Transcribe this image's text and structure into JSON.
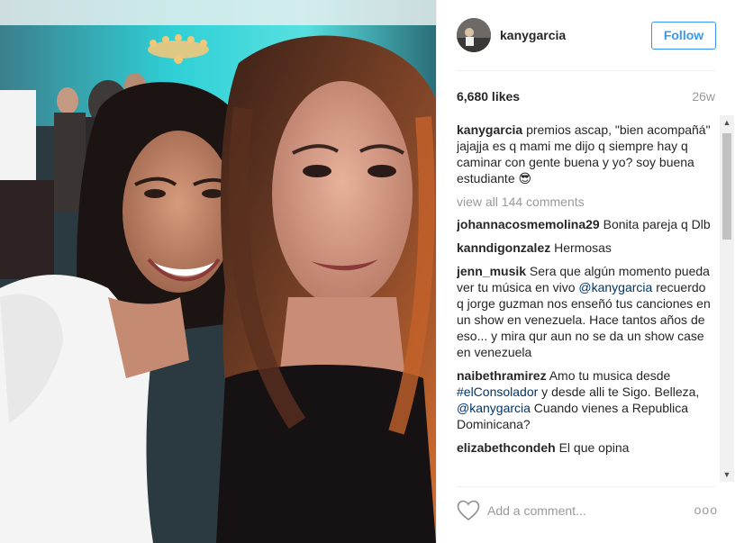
{
  "post": {
    "username": "kanygarcia",
    "follow_label": "Follow",
    "likes": "6,680 likes",
    "age": "26w",
    "caption": {
      "username": "kanygarcia",
      "text": "premios ascap, \"bien acompañá\" jajajja es q mami me dijo q siempre hay q caminar con gente buena y yo? soy buena estudiante 😎"
    },
    "view_all": "view all 144 comments",
    "comments": [
      {
        "username": "johannacosmemolina29",
        "parts": [
          {
            "t": "Bonita pareja q Dlb",
            "m": false
          }
        ]
      },
      {
        "username": "kanndigonzalez",
        "parts": [
          {
            "t": "Hermosas",
            "m": false
          }
        ]
      },
      {
        "username": "jenn_musik",
        "parts": [
          {
            "t": "Sera que algún momento pueda ver tu música en vivo ",
            "m": false
          },
          {
            "t": "@kanygarcia",
            "m": true
          },
          {
            "t": " recuerdo q jorge guzman nos enseñó tus canciones en un show en venezuela. Hace tantos años de eso... y mira qur aun no se da un show case en venezuela",
            "m": false
          }
        ]
      },
      {
        "username": "naibethramirez",
        "parts": [
          {
            "t": "Amo tu musica desde ",
            "m": false
          },
          {
            "t": "#elConsolador",
            "m": true
          },
          {
            "t": " y desde alli te Sigo. Belleza, ",
            "m": false
          },
          {
            "t": "@kanygarcia",
            "m": true
          },
          {
            "t": " Cuando vienes a Republica Dominicana?",
            "m": false
          }
        ]
      },
      {
        "username": "elizabethcondeh",
        "parts": [
          {
            "t": "El que opina",
            "m": false
          }
        ]
      }
    ],
    "add_comment_placeholder": "Add a comment...",
    "more_label": "ooo"
  },
  "colors": {
    "link": "#003569",
    "follow": "#3897f0",
    "muted": "#999999"
  },
  "icons": {
    "like": "heart-outline-icon",
    "more": "more-options-icon",
    "scroll_up": "scroll-up-arrow-icon",
    "scroll_down": "scroll-down-arrow-icon"
  }
}
